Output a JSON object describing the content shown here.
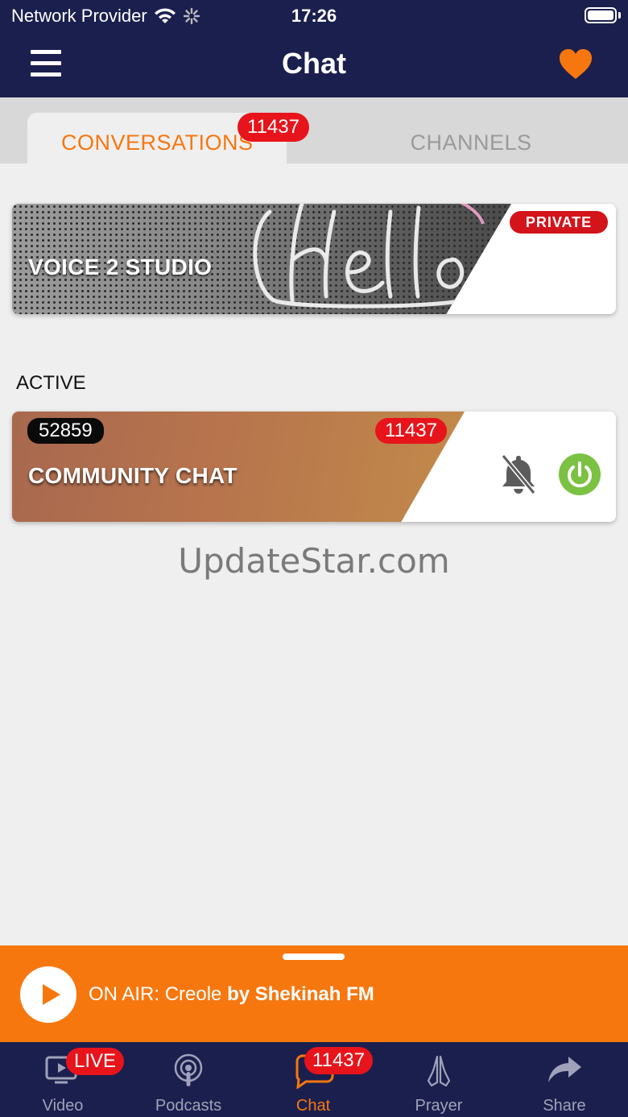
{
  "status_bar": {
    "carrier": "Network Provider",
    "time": "17:26"
  },
  "nav": {
    "title": "Chat",
    "menu_icon": "hamburger-menu-icon",
    "favorite_icon": "heart-icon"
  },
  "tabs": {
    "conversations_label": "CONVERSATIONS",
    "conversations_badge": "11437",
    "channels_label": "CHANNELS",
    "active_tab": "conversations"
  },
  "private_room": {
    "title": "VOICE 2 STUDIO",
    "badge": "PRIVATE"
  },
  "active_section": {
    "label": "ACTIVE",
    "room": {
      "title": "COMMUNITY CHAT",
      "member_count": "52859",
      "unread_badge": "11437",
      "mute_icon": "bell-slash-icon",
      "power_icon": "power-icon"
    }
  },
  "watermark": "UpdateStar.com",
  "player": {
    "prefix": "ON AIR: Creole ",
    "by_line": "by Shekinah FM"
  },
  "tabbar": {
    "items": [
      {
        "label": "Video",
        "icon": "tv-icon",
        "badge": "LIVE"
      },
      {
        "label": "Podcasts",
        "icon": "podcast-icon"
      },
      {
        "label": "Chat",
        "icon": "chat-bubble-icon",
        "badge": "11437",
        "active": true
      },
      {
        "label": "Prayer",
        "icon": "praying-hands-icon"
      },
      {
        "label": "Share",
        "icon": "share-arrow-icon"
      }
    ]
  },
  "colors": {
    "brand_navy": "#1b1f4e",
    "accent_orange": "#f7770f",
    "badge_red": "#e8141b",
    "power_green": "#7bc142"
  }
}
